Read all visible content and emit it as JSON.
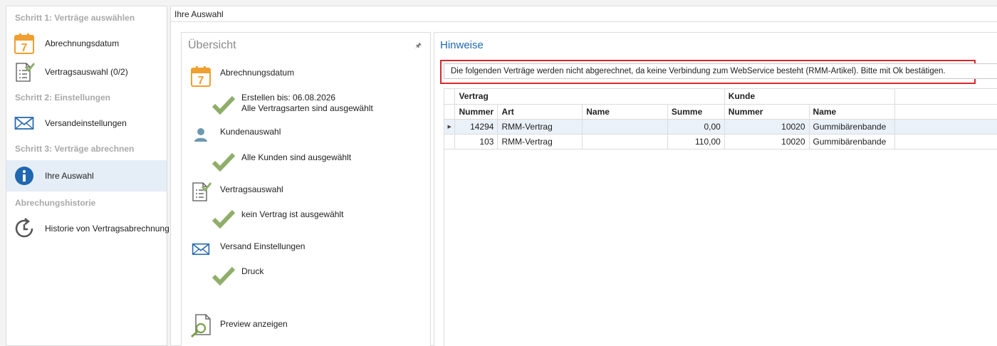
{
  "sidebar": {
    "step1_header": "Schritt 1: Verträge auswählen",
    "item_abrechnungsdatum": "Abrechnungsdatum",
    "calendar_number": "7",
    "item_vertragsauswahl": "Vertragsauswahl (0/2)",
    "step2_header": "Schritt 2: Einstellungen",
    "item_versand": "Versandeinstellungen",
    "step3_header": "Schritt 3: Verträge abrechnen",
    "item_ihre_auswahl": "Ihre Auswahl",
    "history_header": "Abrechungshistorie",
    "item_historie": "Historie von Vertragsabrechnung"
  },
  "main": {
    "title": "Ihre Auswahl"
  },
  "overview": {
    "title": "Übersicht",
    "calendar_number": "7",
    "abrechnungsdatum_label": "Abrechnungsdatum",
    "erstellen_bis": "Erstellen bis: 06.08.2026",
    "vertragsarten": "Alle Vertragsarten sind ausgewählt",
    "kundenauswahl_label": "Kundenauswahl",
    "alle_kunden": "Alle Kunden sind ausgewählt",
    "vertragsauswahl_label": "Vertragsauswahl",
    "kein_vertrag": "kein Vertrag ist ausgewählt",
    "versand_label": "Versand Einstellungen",
    "druck": "Druck",
    "preview_label": "Preview anzeigen"
  },
  "hinweise": {
    "title": "Hinweise",
    "message": "Die folgenden Verträge werden nicht abgerechnet, da keine Verbindung zum WebService besteht (RMM-Artikel). Bitte mit Ok bestätigen."
  },
  "table": {
    "group_vertrag": "Vertrag",
    "group_kunde": "Kunde",
    "columns": [
      "Nummer",
      "Art",
      "Name",
      "Summe",
      "Nummer",
      "Name"
    ],
    "rows": [
      [
        "14294",
        "RMM-Vertrag",
        "",
        "0,00",
        "10020",
        "Gummibärenbande"
      ],
      [
        "103",
        "RMM-Vertrag",
        "",
        "110,00",
        "10020",
        "Gummibärenbande"
      ]
    ]
  },
  "colors": {
    "accent": "#1f68b1",
    "check": "#8fae6a",
    "highlight_border": "#d9292e",
    "calendar": "#f0a030"
  }
}
